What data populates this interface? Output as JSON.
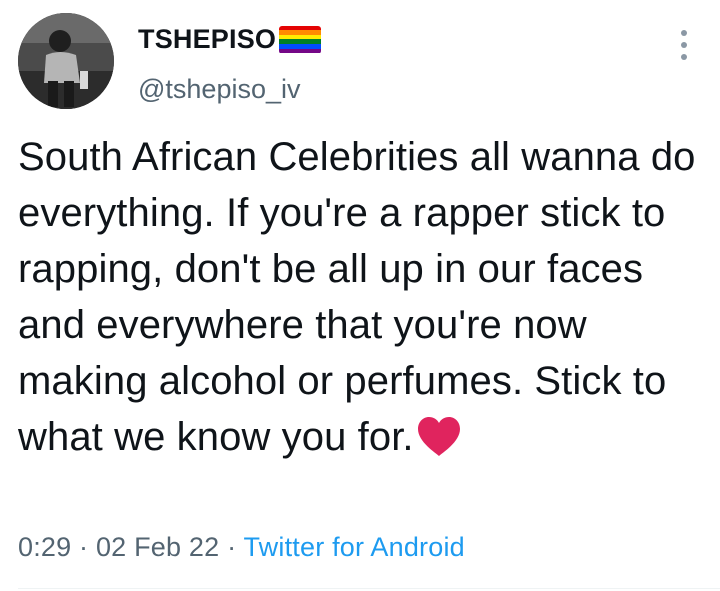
{
  "author": {
    "display_name": "TSHEPISO",
    "handle": "@tshepiso_iv",
    "flag_icon": "rainbow-flag",
    "flag_colors": [
      "#e40303",
      "#ff8c00",
      "#ffed00",
      "#008026",
      "#004dff",
      "#750787"
    ]
  },
  "tweet": {
    "text": "South African Celebrities all wanna do everything. If you're a rapper stick to rapping, don't be all up in our faces and everywhere that you're now making alcohol or perfumes. Stick to what we know you for.",
    "emoji_icon": "red-heart",
    "heart_color": "#e0245e"
  },
  "meta": {
    "time": "0:29",
    "separator": " · ",
    "date": "02 Feb 22",
    "source": "Twitter for Android",
    "source_color": "#1d9bf0"
  },
  "more_icon": "vertical-ellipsis"
}
